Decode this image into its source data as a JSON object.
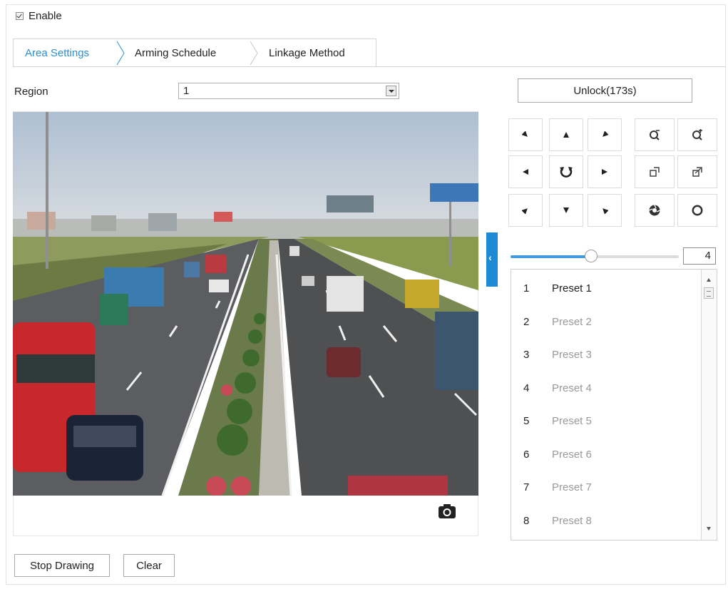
{
  "enable": {
    "label": "Enable",
    "checked": true
  },
  "tabs": [
    {
      "label": "Area Settings",
      "active": true
    },
    {
      "label": "Arming Schedule",
      "active": false
    },
    {
      "label": "Linkage Method",
      "active": false
    }
  ],
  "region": {
    "label": "Region",
    "value": "1"
  },
  "buttons": {
    "stop_drawing": "Stop Drawing",
    "clear": "Clear",
    "unlock": "Unlock(173s)"
  },
  "ptz": {
    "controls": [
      "pan-up-left-icon",
      "pan-up-icon",
      "pan-up-right-icon",
      "zoom-out-icon",
      "zoom-in-icon",
      "pan-left-icon",
      "auto-pan-icon",
      "pan-right-icon",
      "focus-near-icon",
      "focus-far-icon",
      "pan-down-left-icon",
      "pan-down-icon",
      "pan-down-right-icon",
      "iris-close-icon",
      "iris-open-icon"
    ],
    "speed": 4,
    "speed_fraction": 0.5
  },
  "presets": [
    {
      "num": "1",
      "name": "Preset 1"
    },
    {
      "num": "2",
      "name": "Preset 2"
    },
    {
      "num": "3",
      "name": "Preset 3"
    },
    {
      "num": "4",
      "name": "Preset 4"
    },
    {
      "num": "5",
      "name": "Preset 5"
    },
    {
      "num": "6",
      "name": "Preset 6"
    },
    {
      "num": "7",
      "name": "Preset 7"
    },
    {
      "num": "8",
      "name": "Preset 8"
    }
  ],
  "colors": {
    "accent": "#1d8ad6",
    "tab_active": "#2a8fcf",
    "slider_fill": "#3f9de0"
  },
  "icons": {
    "snapshot": "camera-icon",
    "collapse": "chevron-left-icon"
  }
}
